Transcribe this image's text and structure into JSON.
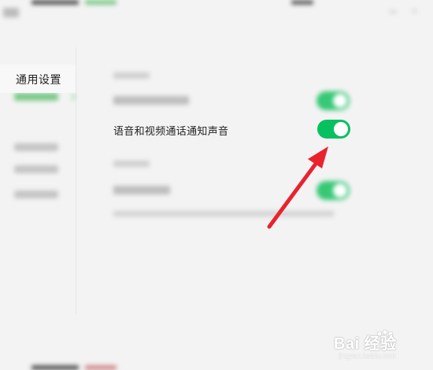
{
  "sidebar": {
    "current_label": "通用设置"
  },
  "main": {
    "voice_video_notify_label": "语音和视频通话通知声音",
    "voice_video_notify_on": true
  },
  "watermark": {
    "text": "Bai 经验",
    "sub": "jingyan.baidu.com"
  },
  "colors": {
    "toggle_on": "#07c160",
    "arrow": "#e8232e",
    "background": "#f3f3f3"
  }
}
